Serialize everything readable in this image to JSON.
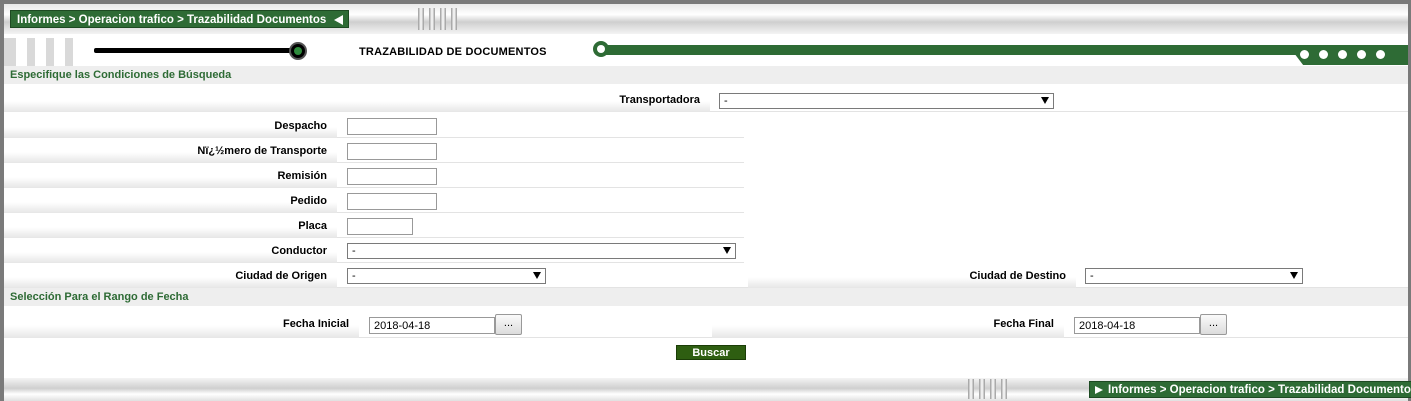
{
  "breadcrumb_top": "Informes > Operacion trafico > Trazabilidad Documentos",
  "page_title": "TRAZABILIDAD DE DOCUMENTOS",
  "section_search": "Especifique las Condiciones de Búsqueda",
  "section_dates": "Selección Para el Rango de Fecha",
  "fields": {
    "transportadora": {
      "label": "Transportadora",
      "value": "-"
    },
    "despacho": {
      "label": "Despacho",
      "value": ""
    },
    "numero_transporte": {
      "label": "Nï¿½mero de Transporte",
      "value": ""
    },
    "remision": {
      "label": "Remisión",
      "value": ""
    },
    "pedido": {
      "label": "Pedido",
      "value": ""
    },
    "placa": {
      "label": "Placa",
      "value": ""
    },
    "conductor": {
      "label": "Conductor",
      "value": "-"
    },
    "ciudad_origen": {
      "label": "Ciudad de Origen",
      "value": "-"
    },
    "ciudad_destino": {
      "label": "Ciudad de Destino",
      "value": "-"
    },
    "fecha_inicial": {
      "label": "Fecha Inicial",
      "value": "2018-04-18"
    },
    "fecha_final": {
      "label": "Fecha Final",
      "value": "2018-04-18"
    }
  },
  "calendar_button_label": "...",
  "search_button_label": "Buscar",
  "breadcrumb_bottom": "Informes > Operacion trafico > Trazabilidad Documentos",
  "colors": {
    "brand_green": "#2e6b35",
    "button_green": "#2e5e11"
  }
}
